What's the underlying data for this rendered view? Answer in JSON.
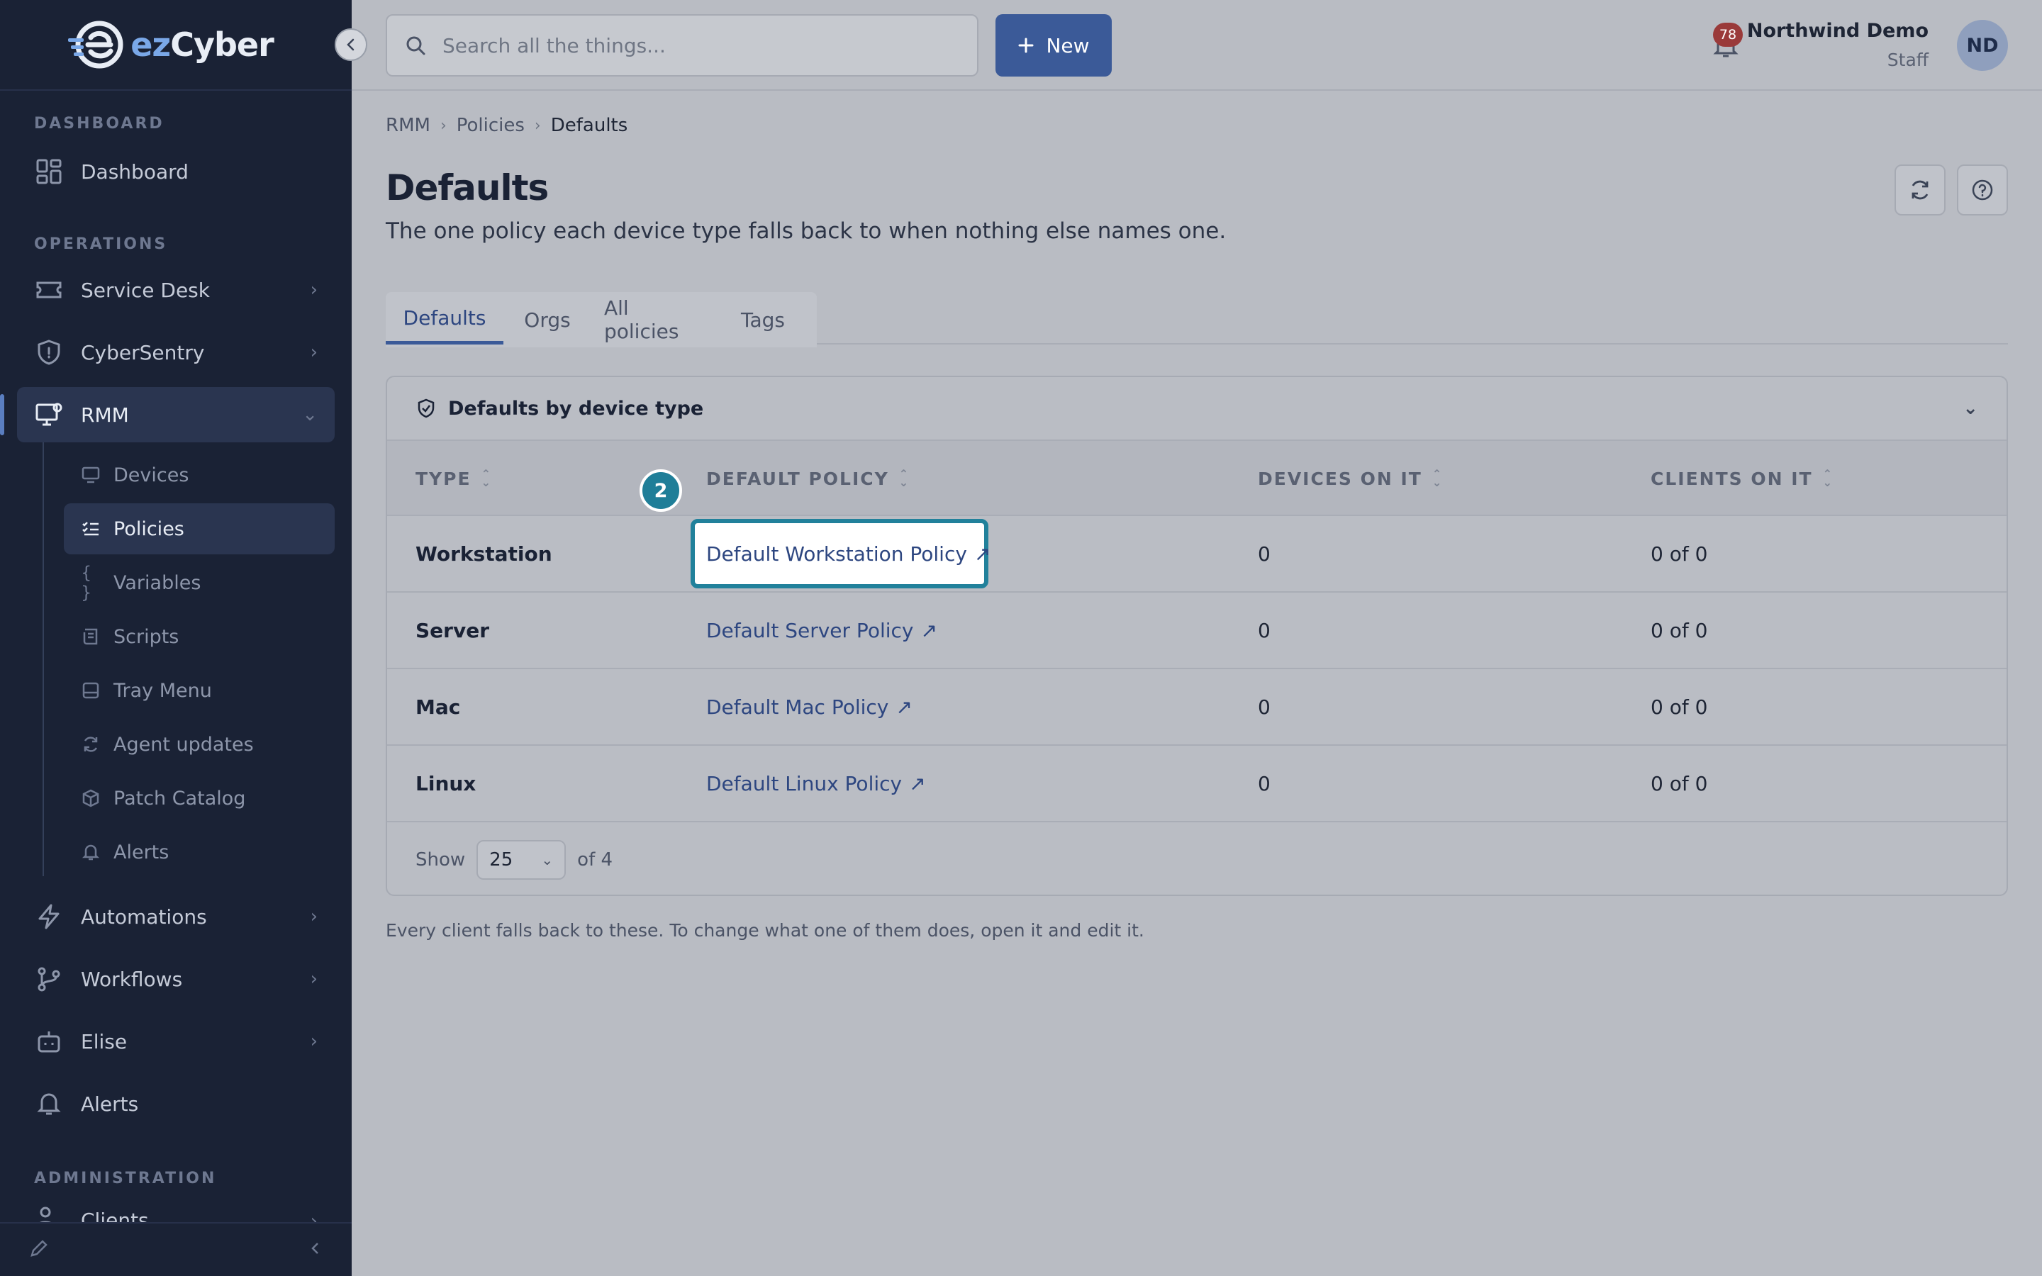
{
  "brand": {
    "name_prefix": "ez",
    "name_suffix": "Cyber"
  },
  "sidebar": {
    "sections": {
      "dashboard": "DASHBOARD",
      "operations": "OPERATIONS",
      "administration": "ADMINISTRATION"
    },
    "items": [
      {
        "label": "Dashboard"
      },
      {
        "label": "Service Desk"
      },
      {
        "label": "CyberSentry"
      },
      {
        "label": "RMM"
      },
      {
        "label": "Automations"
      },
      {
        "label": "Workflows"
      },
      {
        "label": "Elise"
      },
      {
        "label": "Alerts"
      },
      {
        "label": "Clients"
      }
    ],
    "rmm_subitems": [
      {
        "label": "Devices"
      },
      {
        "label": "Policies"
      },
      {
        "label": "Variables"
      },
      {
        "label": "Scripts"
      },
      {
        "label": "Tray Menu"
      },
      {
        "label": "Agent updates"
      },
      {
        "label": "Patch Catalog"
      },
      {
        "label": "Alerts"
      }
    ]
  },
  "topbar": {
    "search_placeholder": "Search all the things...",
    "new_label": "New",
    "notification_count": "78",
    "user_name": "Northwind Demo",
    "user_role": "Staff",
    "avatar_initials": "ND"
  },
  "breadcrumb": [
    "RMM",
    "Policies",
    "Defaults"
  ],
  "page": {
    "title": "Defaults",
    "subtitle": "The one policy each device type falls back to when nothing else names one."
  },
  "tabs": [
    "Defaults",
    "Orgs",
    "All policies",
    "Tags"
  ],
  "card": {
    "title": "Defaults by device type",
    "columns": [
      "TYPE",
      "DEFAULT POLICY",
      "DEVICES ON IT",
      "CLIENTS ON IT"
    ],
    "rows": [
      {
        "type": "Workstation",
        "policy": "Default Workstation Policy",
        "devices": "0",
        "clients": "0 of 0"
      },
      {
        "type": "Server",
        "policy": "Default Server Policy",
        "devices": "0",
        "clients": "0 of 0"
      },
      {
        "type": "Mac",
        "policy": "Default Mac Policy",
        "devices": "0",
        "clients": "0 of 0"
      },
      {
        "type": "Linux",
        "policy": "Default Linux Policy",
        "devices": "0",
        "clients": "0 of 0"
      }
    ],
    "footer": {
      "show_label": "Show",
      "page_size": "25",
      "total": "of 4"
    }
  },
  "footnote": "Every client falls back to these. To change what one of them does, open it and edit it.",
  "step_badge": "2",
  "colors": {
    "sidebar_bg": "#1a2235",
    "accent": "#3b5a98",
    "highlight": "#21819b",
    "badge": "#9a3a3a"
  },
  "icons": [
    "search-icon",
    "plus-icon",
    "bell-icon",
    "refresh-icon",
    "help-icon",
    "shield-check-icon",
    "chevron-down-icon",
    "external-link-icon"
  ]
}
